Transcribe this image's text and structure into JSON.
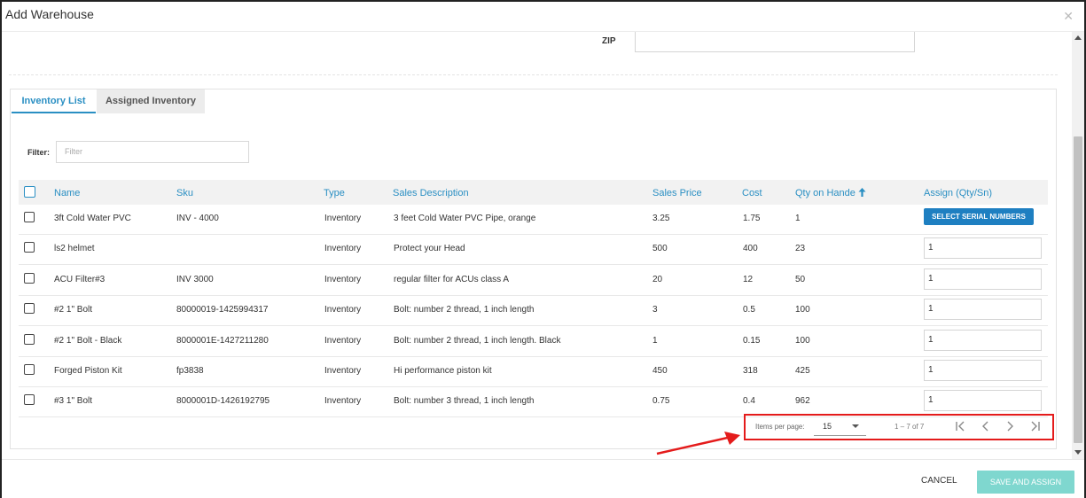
{
  "dialog": {
    "title": "Add Warehouse",
    "close_icon": "close-icon"
  },
  "form": {
    "zip_label": "ZIP",
    "zip_value": ""
  },
  "tabs": [
    {
      "label": "Inventory List",
      "active": true
    },
    {
      "label": "Assigned Inventory",
      "active": false
    }
  ],
  "filter": {
    "label": "Filter:",
    "placeholder": "Filter"
  },
  "table": {
    "columns": [
      "Name",
      "Sku",
      "Type",
      "Sales Description",
      "Sales Price",
      "Cost",
      "Qty on Hande",
      "Assign (Qty/Sn)"
    ],
    "sort_icon": "arrow-up-icon",
    "rows": [
      {
        "name": "3ft Cold Water PVC",
        "sku": "INV - 4000",
        "type": "Inventory",
        "desc": "3 feet Cold Water PVC Pipe, orange",
        "price": "3.25",
        "cost": "1.75",
        "qty": "1",
        "assign": "SELECT SERIAL NUMBERS",
        "assign_is_button": true
      },
      {
        "name": "ls2 helmet",
        "sku": "",
        "type": "Inventory",
        "desc": "Protect your Head",
        "price": "500",
        "cost": "400",
        "qty": "23",
        "assign": "1",
        "assign_is_button": false
      },
      {
        "name": "ACU Filter#3",
        "sku": "INV 3000",
        "type": "Inventory",
        "desc": "regular filter for ACUs class A",
        "price": "20",
        "cost": "12",
        "qty": "50",
        "assign": "1",
        "assign_is_button": false
      },
      {
        "name": "#2 1\" Bolt",
        "sku": "80000019-1425994317",
        "type": "Inventory",
        "desc": "Bolt: number 2 thread, 1 inch length",
        "price": "3",
        "cost": "0.5",
        "qty": "100",
        "assign": "1",
        "assign_is_button": false
      },
      {
        "name": "#2 1\" Bolt - Black",
        "sku": "8000001E-1427211280",
        "type": "Inventory",
        "desc": "Bolt: number 2 thread, 1 inch length. Black",
        "price": "1",
        "cost": "0.15",
        "qty": "100",
        "assign": "1",
        "assign_is_button": false
      },
      {
        "name": "Forged Piston Kit",
        "sku": "fp3838",
        "type": "Inventory",
        "desc": "Hi performance piston kit",
        "price": "450",
        "cost": "318",
        "qty": "425",
        "assign": "1",
        "assign_is_button": false
      },
      {
        "name": "#3 1\" Bolt",
        "sku": "8000001D-1426192795",
        "type": "Inventory",
        "desc": "Bolt: number 3 thread, 1 inch length",
        "price": "0.75",
        "cost": "0.4",
        "qty": "962",
        "assign": "1",
        "assign_is_button": false
      }
    ]
  },
  "paginator": {
    "items_label": "Items per page:",
    "page_size": "15",
    "range": "1 – 7 of 7",
    "icons": [
      "first-page-icon",
      "prev-page-icon",
      "next-page-icon",
      "last-page-icon"
    ]
  },
  "footer": {
    "cancel_label": "CANCEL",
    "save_label": "SAVE AND ASSIGN"
  },
  "colors": {
    "accent": "#2a8fc3",
    "button_blue": "#1e7fc1",
    "save_disabled": "#7fd7cf",
    "highlight_red": "#e41b1b"
  }
}
